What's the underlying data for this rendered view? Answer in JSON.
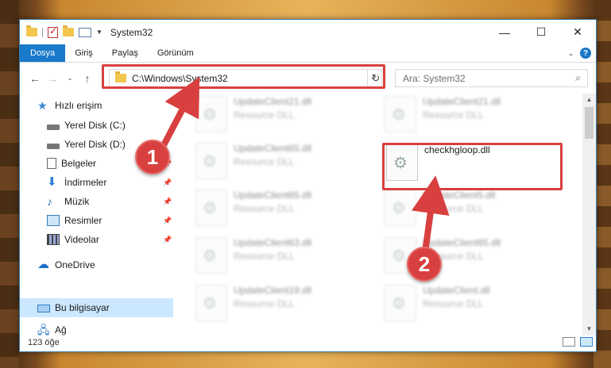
{
  "window": {
    "title": "System32",
    "controls": {
      "minimize": "—",
      "maximize": "☐",
      "close": "✕"
    }
  },
  "ribbon": {
    "tabs": [
      "Dosya",
      "Giriş",
      "Paylaş",
      "Görünüm"
    ]
  },
  "address": {
    "path": "C:\\Windows\\System32",
    "search_placeholder": "Ara: System32"
  },
  "nav": {
    "items": [
      {
        "label": "Hızlı erişim",
        "icon": "star-icon"
      },
      {
        "label": "Yerel Disk (C:)",
        "icon": "disk-icon"
      },
      {
        "label": "Yerel Disk (D:)",
        "icon": "disk-icon"
      },
      {
        "label": "Belgeler",
        "icon": "document-icon"
      },
      {
        "label": "İndirmeler",
        "icon": "download-icon"
      },
      {
        "label": "Müzik",
        "icon": "music-icon"
      },
      {
        "label": "Resimler",
        "icon": "pictures-icon"
      },
      {
        "label": "Videolar",
        "icon": "videos-icon"
      },
      {
        "label": "OneDrive",
        "icon": "cloud-icon"
      },
      {
        "label": "Bu bilgisayar",
        "icon": "computer-icon"
      },
      {
        "label": "Ağ",
        "icon": "network-icon"
      }
    ]
  },
  "files": {
    "col1": [
      {
        "name": "UpdateClient21.dll",
        "type": "Resource DLL"
      },
      {
        "name": "UpdateClient65.dll",
        "type": "Resource DLL"
      },
      {
        "name": "UpdateClient65.dll",
        "type": "Resource DLL"
      },
      {
        "name": "UpdateClient63.dll",
        "type": "Resource DLL"
      },
      {
        "name": "UpdateClient19.dll",
        "type": "Resource DLL"
      }
    ],
    "col2": [
      {
        "name": "UpdateClient21.dll",
        "type": "Resource DLL"
      },
      {
        "name": "checkhgloop.dll",
        "type": ""
      },
      {
        "name": "UpdateClient5.dll",
        "type": "Resource DLL"
      },
      {
        "name": "UpdateClient65.dll",
        "type": "Resource DLL"
      },
      {
        "name": "UpdateClient.dll",
        "type": "Resource DLL"
      }
    ]
  },
  "status": {
    "count": "123 öğe"
  },
  "callouts": {
    "one": "1",
    "two": "2"
  },
  "colors": {
    "accent": "#1979ca",
    "highlight": "#d8403f",
    "selected": "#cce8ff"
  }
}
